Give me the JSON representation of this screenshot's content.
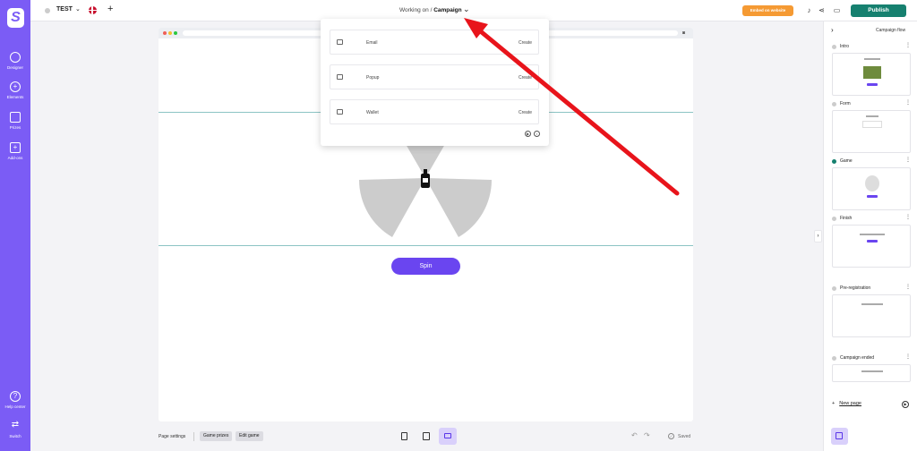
{
  "header": {
    "project_name": "TEST",
    "working_on_label": "Working on",
    "working_on_sep": "/",
    "working_on_value": "Campaign",
    "embed_label": "Embed on website",
    "publish_label": "Publish"
  },
  "sidebar": {
    "items": [
      {
        "label": "Designer",
        "icon": "palette-icon"
      },
      {
        "label": "Elements",
        "icon": "plus-circle-icon"
      },
      {
        "label": "Prizes",
        "icon": "gift-icon"
      },
      {
        "label": "Add-ons",
        "icon": "grid-plus-icon"
      },
      {
        "label": "Help center",
        "icon": "help-icon"
      },
      {
        "label": "Switch",
        "icon": "swap-icon"
      }
    ]
  },
  "dropdown": {
    "items": [
      {
        "label": "Email",
        "action": "Create",
        "icon": "image-icon"
      },
      {
        "label": "Popup",
        "action": "Create",
        "icon": "copy-icon"
      },
      {
        "label": "Wallet",
        "action": "Create",
        "icon": "window-icon"
      }
    ]
  },
  "canvas": {
    "spin_label": "Spin"
  },
  "bottombar": {
    "page_settings": "Page settings",
    "game_prizes": "Game prizes",
    "edit_game": "Edit game",
    "saved": "Saved"
  },
  "rightpanel": {
    "title": "Campaign flow",
    "new_page_plus": "+",
    "new_page": "New page",
    "flows": [
      {
        "name": "Intro",
        "status": "inactive"
      },
      {
        "name": "Form",
        "status": "inactive"
      },
      {
        "name": "Game",
        "status": "active"
      },
      {
        "name": "Finish",
        "status": "inactive"
      },
      {
        "name": "Pre-registration",
        "status": "inactive"
      },
      {
        "name": "Campaign ended",
        "status": "inactive"
      }
    ]
  },
  "colors": {
    "rail": "#7b5cf5",
    "accent": "#6a45f0",
    "publish": "#16806f",
    "embed": "#f59a33",
    "active_dot": "#16806f",
    "arrow": "#e8141b"
  }
}
